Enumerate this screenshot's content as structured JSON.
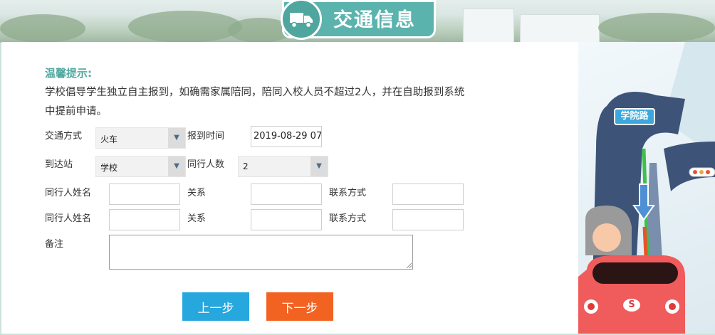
{
  "header": {
    "title": "交通信息",
    "icon": "truck-icon"
  },
  "tip": {
    "title": "温馨提示:",
    "text": "学校倡导学生独立自主报到，如确需家属陪同，陪同入校人员不超过2人，并在自助报到系统中提前申请。"
  },
  "form": {
    "transport_label": "交通方式",
    "transport_value": "火车",
    "arrival_time_label": "报到时间",
    "arrival_time_value": "2019-08-29 07",
    "station_label": "到达站",
    "station_value": "学校",
    "companions_label": "同行人数",
    "companions_value": "2",
    "companion_rows": [
      {
        "name_label": "同行人姓名",
        "relation_label": "关系",
        "contact_label": "联系方式"
      },
      {
        "name_label": "同行人姓名",
        "relation_label": "关系",
        "contact_label": "联系方式"
      }
    ],
    "remark_label": "备注"
  },
  "buttons": {
    "prev": "上一步",
    "next": "下一步"
  },
  "illustration": {
    "road_sign": "学院路",
    "car_emblem": "S"
  },
  "colors": {
    "teal": "#5bb3ad",
    "prev_button": "#26a7de",
    "next_button": "#f26322"
  }
}
